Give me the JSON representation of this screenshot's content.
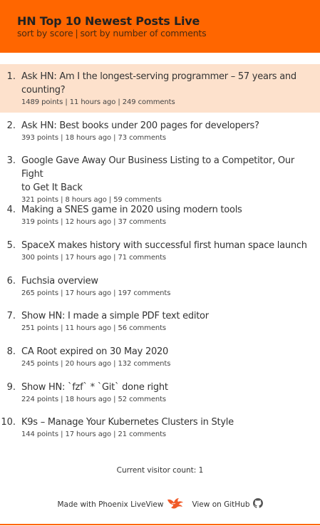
{
  "header": {
    "title": "HN Top 10 Newest Posts Live",
    "sort_score": "sort by score",
    "separator": "|",
    "sort_comments": "sort by number of comments"
  },
  "posts": [
    {
      "rank": "1.",
      "title_line1": "Ask HN: Am I the longest-serving programmer – 57 years and",
      "title_line2": "counting?",
      "points": "1489 points",
      "age": "11 hours ago",
      "comments": "249 comments"
    },
    {
      "rank": "2.",
      "title_line1": "Ask HN: Best books under 200 pages for developers?",
      "title_line2": "",
      "points": "393 points",
      "age": "18 hours ago",
      "comments": "73 comments"
    },
    {
      "rank": "3.",
      "title_line1": "Google Gave Away Our Business Listing to a Competitor, Our Fight",
      "title_line2": "to Get It Back",
      "points": "321 points",
      "age": "8 hours ago",
      "comments": "59 comments"
    },
    {
      "rank": "4.",
      "title_line1": "Making a SNES game in 2020 using modern tools",
      "title_line2": "",
      "points": "319 points",
      "age": "12 hours ago",
      "comments": "37 comments"
    },
    {
      "rank": "5.",
      "title_line1": "SpaceX makes history with successful first human space launch",
      "title_line2": "",
      "points": "300 points",
      "age": "17 hours ago",
      "comments": "71 comments"
    },
    {
      "rank": "6.",
      "title_line1": "Fuchsia overview",
      "title_line2": "",
      "points": "265 points",
      "age": "17 hours ago",
      "comments": "197 comments"
    },
    {
      "rank": "7.",
      "title_line1": "Show HN: I made a simple PDF text editor",
      "title_line2": "",
      "points": "251 points",
      "age": "11 hours ago",
      "comments": "56 comments"
    },
    {
      "rank": "8.",
      "title_line1": "CA Root expired on 30 May 2020",
      "title_line2": "",
      "points": "245 points",
      "age": "20 hours ago",
      "comments": "132 comments"
    },
    {
      "rank": "9.",
      "title_line1": "Show HN: `fzf` * `Git` done right",
      "title_line2": "",
      "points": "224 points",
      "age": "18 hours ago",
      "comments": "52 comments"
    },
    {
      "rank": "10.",
      "title_line1": "K9s – Manage Your Kubernetes Clusters in Style",
      "title_line2": "",
      "points": "144 points",
      "age": "17 hours ago",
      "comments": "21 comments"
    }
  ],
  "meta_separator": "|",
  "visitor_count": "Current visitor count: 1",
  "footer": {
    "made_with": "Made with Phoenix LiveView",
    "view_github": "View on GitHub",
    "phoenix_icon": "phoenix-icon",
    "github_icon": "github-icon"
  },
  "colors": {
    "header_bg": "#ff6600",
    "highlight_bg": "#fde1cc"
  }
}
